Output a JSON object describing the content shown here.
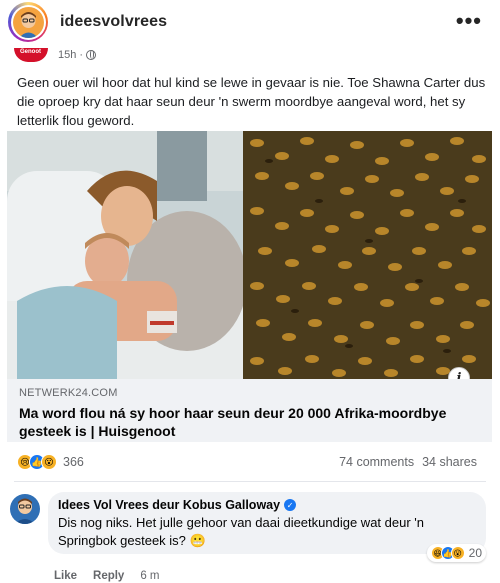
{
  "header": {
    "username": "ideesvolvrees",
    "more_icon": "more-horizontal-icon"
  },
  "post": {
    "page_badge": "Genoot",
    "time": "15h ·",
    "text": "Geen ouer wil hoor dat hul kind se lewe in gevaar is nie. Toe Shawna Carter dus die oproep kry dat haar seun deur 'n swerm moordbye aangeval word, het sy letterlik flou geword.",
    "link": {
      "domain": "NETWERK24.COM",
      "title": "Ma word flou ná sy hoor haar seun deur 20 000 Afrika-moordbye gesteek is | Huisgenoot"
    },
    "reactions": {
      "count": "366",
      "comments": "74 comments",
      "shares": "34 shares",
      "icons": [
        "sad-react-icon",
        "like-react-icon",
        "wow-react-icon"
      ]
    }
  },
  "comment": {
    "author": "Idees Vol Vrees deur Kobus Galloway",
    "text": "Dis nog niks. Het julle gehoor van daai dieetkundige wat deur 'n Springbok gesteek is? 😬",
    "reaction_count": "20",
    "like_label": "Like",
    "reply_label": "Reply",
    "time": "6 m"
  },
  "colors": {
    "fb_blue": "#1877f2",
    "grey_text": "#65676b",
    "bubble": "#f0f2f5"
  }
}
